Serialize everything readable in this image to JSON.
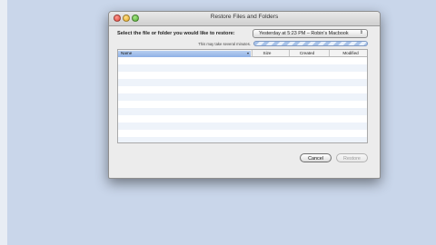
{
  "window": {
    "title": "Restore Files and Folders"
  },
  "prompt": "Select the file or folder you would like to restore:",
  "source_popup": {
    "selected": "Yesterday at 5:23 PM – Robin's Macbook"
  },
  "hint": "This may take several minutes.",
  "table": {
    "columns": [
      "Name",
      "Size",
      "Created",
      "Modified"
    ],
    "rows": []
  },
  "buttons": {
    "cancel": "Cancel",
    "restore": "Restore"
  }
}
